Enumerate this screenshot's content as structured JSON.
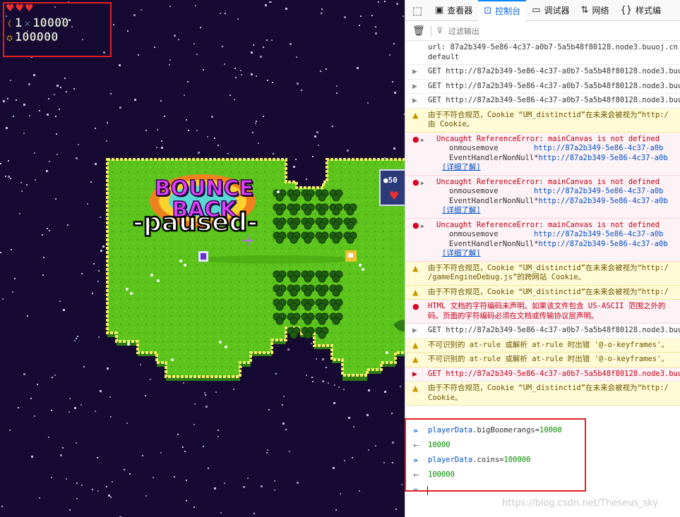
{
  "hud": {
    "hearts": "♥♥♥",
    "boomerang_count": "1",
    "big_boomerangs": "10000",
    "coins": "100000"
  },
  "game": {
    "title_line1": "BOUNCE",
    "title_line2": "BACK",
    "paused_label": "-paused-",
    "mini_panel_coins": "50"
  },
  "devtools": {
    "toolbar": {
      "inspector": "查看器",
      "console": "控制台",
      "debugger": "调试器",
      "network": "网络",
      "style_editor": "样式编"
    },
    "filter_placeholder": "过滤输出",
    "log": [
      {
        "type": "plain",
        "text": "url: 87a2b349-5e86-4c37-a0b7-5a5b48f80128.node3.buuoj.cn\ndefault"
      },
      {
        "type": "net",
        "text": "GET http://87a2b349-5e86-4c37-a0b7-5a5b48f80128.node3.buuoj"
      },
      {
        "type": "net",
        "text": "GET http://87a2b349-5e86-4c37-a0b7-5a5b48f80128.node3.buuoj"
      },
      {
        "type": "net",
        "text": "GET http://87a2b349-5e86-4c37-a0b7-5a5b48f80128.node3.buuoj"
      },
      {
        "type": "warn",
        "text": "由于不符合规范，Cookie “UM_distinctid”在未来会被视为“http:/\n由 Cookie。"
      },
      {
        "type": "error",
        "text": "Uncaught ReferenceError: mainCanvas is not defined",
        "stack": [
          [
            "onmousemove",
            "http://87a2b349-5e86-4c37-a0b"
          ],
          [
            "EventHandlerNonNull*",
            "http://87a2b349-5e86-4c37-a0b"
          ]
        ],
        "more": "[详细了解]"
      },
      {
        "type": "error",
        "text": "Uncaught ReferenceError: mainCanvas is not defined",
        "stack": [
          [
            "onmousemove",
            "http://87a2b349-5e86-4c37-a0b"
          ],
          [
            "EventHandlerNonNull*",
            "http://87a2b349-5e86-4c37-a0b"
          ]
        ],
        "more": "[详细了解]"
      },
      {
        "type": "error",
        "text": "Uncaught ReferenceError: mainCanvas is not defined",
        "stack": [
          [
            "onmousemove",
            "http://87a2b349-5e86-4c37-a0b"
          ],
          [
            "EventHandlerNonNull*",
            "http://87a2b349-5e86-4c37-a0b"
          ]
        ],
        "more": "[详细了解]"
      },
      {
        "type": "warn",
        "text": "由于不符合规范，Cookie “UM_distinctid”在未来会被视为“http:/\n/gameEngineDebug.js”的跨网站 Cookie。"
      },
      {
        "type": "warn",
        "text": "由于不符合规范，Cookie “UM_distinctid”在未来会被视为“http:/"
      },
      {
        "type": "error",
        "text": "HTML 文档的字符编码未声明。如果该文件包含 US-ASCII 范围之外的\n码。页面的字符编码必须在文档或传输协议层声明。"
      },
      {
        "type": "net",
        "text": "GET http://87a2b349-5e86-4c37-a0b7-5a5b48f80128.node3.buuoj"
      },
      {
        "type": "warn",
        "text": "不可识别的 at-rule 或解析 at-rule 时出错 '@-o-keyframes'。"
      },
      {
        "type": "warn",
        "text": "不可识别的 at-rule 或解析 at-rule 时出错 '@-o-keyframes'。"
      },
      {
        "type": "neterr",
        "text": "GET http://87a2b349-5e86-4c37-a0b7-5a5b48f80128.node3.buuoj"
      },
      {
        "type": "warn",
        "text": "由于不符合规范，Cookie “UM_distinctid”在未来会被视为“http:/\nCookie。"
      }
    ],
    "commands": [
      {
        "var": "playerData",
        "prop": ".bigBoomerangs=",
        "val": "10000",
        "result": "10000"
      },
      {
        "var": "playerData",
        "prop": ".coins=",
        "val": "100000",
        "result": "100000"
      }
    ],
    "input_prompt": "»"
  },
  "watermark": "https://blog.csdn.net/Theseus_sky",
  "icons": {
    "picker": "element-picker-icon",
    "trash": "trash-icon",
    "filter": "filter-icon"
  },
  "colors": {
    "space": "#160a33",
    "grass": "#5cc41c",
    "border": "#f6ec6a",
    "active_tab": "#0a84ff"
  }
}
